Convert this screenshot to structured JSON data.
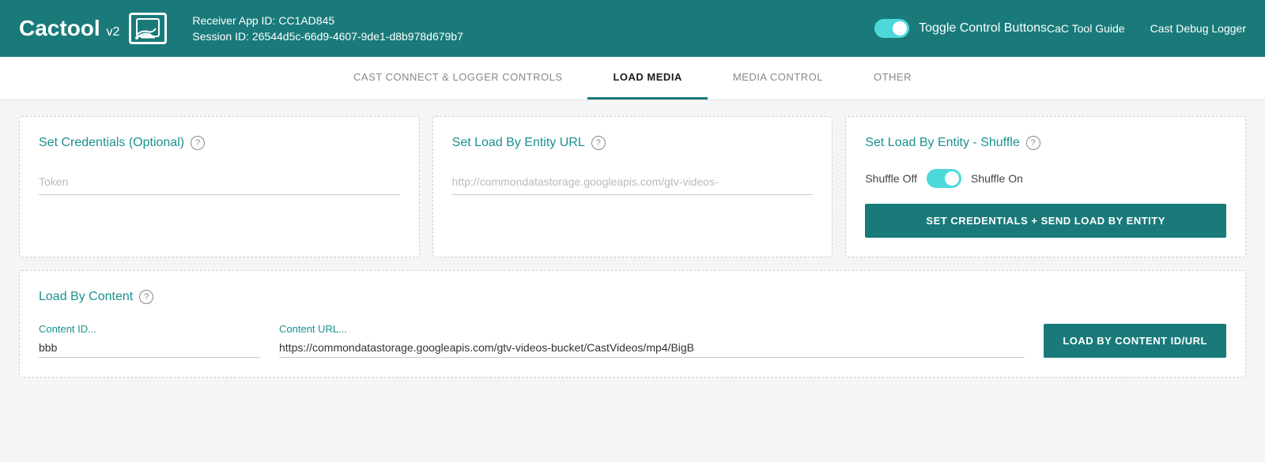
{
  "header": {
    "logo_text": "Cactool",
    "logo_version": "v2",
    "receiver_label": "Receiver App ID:",
    "receiver_id": "CC1AD845",
    "session_label": "Session ID:",
    "session_id": "26544d5c-66d9-4607-9de1-d8b978d679b7",
    "toggle_label": "Toggle Control Buttons",
    "nav_guide": "CaC Tool Guide",
    "nav_logger": "Cast Debug Logger"
  },
  "tabs": [
    {
      "id": "cast-connect",
      "label": "CAST CONNECT & LOGGER CONTROLS",
      "active": false
    },
    {
      "id": "load-media",
      "label": "LOAD MEDIA",
      "active": true
    },
    {
      "id": "media-control",
      "label": "MEDIA CONTROL",
      "active": false
    },
    {
      "id": "other",
      "label": "OTHER",
      "active": false
    }
  ],
  "cards": {
    "credentials": {
      "title": "Set Credentials (Optional)",
      "token_placeholder": "Token"
    },
    "entity_url": {
      "title": "Set Load By Entity URL",
      "url_placeholder": "http://commondatastorage.googleapis.com/gtv-videos-"
    },
    "shuffle": {
      "title": "Set Load By Entity - Shuffle",
      "shuffle_off_label": "Shuffle Off",
      "shuffle_on_label": "Shuffle On",
      "button_label": "SET CREDENTIALS + SEND LOAD BY ENTITY"
    },
    "load_content": {
      "title": "Load By Content",
      "content_id_label": "Content ID...",
      "content_id_value": "bbb",
      "content_url_label": "Content URL...",
      "content_url_value": "https://commondatastorage.googleapis.com/gtv-videos-bucket/CastVideos/mp4/BigB",
      "button_label": "LOAD BY CONTENT ID/URL"
    }
  },
  "icons": {
    "help": "?",
    "cast_symbol": "⊟"
  }
}
